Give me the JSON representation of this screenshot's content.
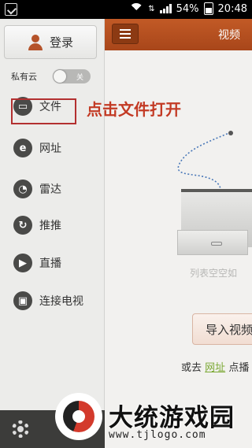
{
  "status_bar": {
    "battery": "54%",
    "time": "20:48"
  },
  "sidebar": {
    "login_label": "登录",
    "private_cloud_label": "私有云",
    "private_cloud_toggle": "关",
    "items": [
      {
        "label": "文件",
        "icon": "file-icon"
      },
      {
        "label": "网址",
        "icon": "ie-icon"
      },
      {
        "label": "雷达",
        "icon": "radar-icon"
      },
      {
        "label": "推推",
        "icon": "push-icon"
      },
      {
        "label": "直播",
        "icon": "live-icon"
      },
      {
        "label": "连接电视",
        "icon": "tv-icon"
      }
    ]
  },
  "header": {
    "title": "视频"
  },
  "main": {
    "empty_text": "列表空空如",
    "import_button": "导入视频",
    "or_prefix": "或去",
    "or_link": "网址",
    "or_suffix": "点播"
  },
  "annotation": "点击文件打开",
  "watermark": {
    "name": "大统游戏园",
    "url": "www.tjlogo.com"
  },
  "colors": {
    "accent": "#b34e20",
    "annotation": "#c33a24",
    "link": "#7aa832"
  }
}
